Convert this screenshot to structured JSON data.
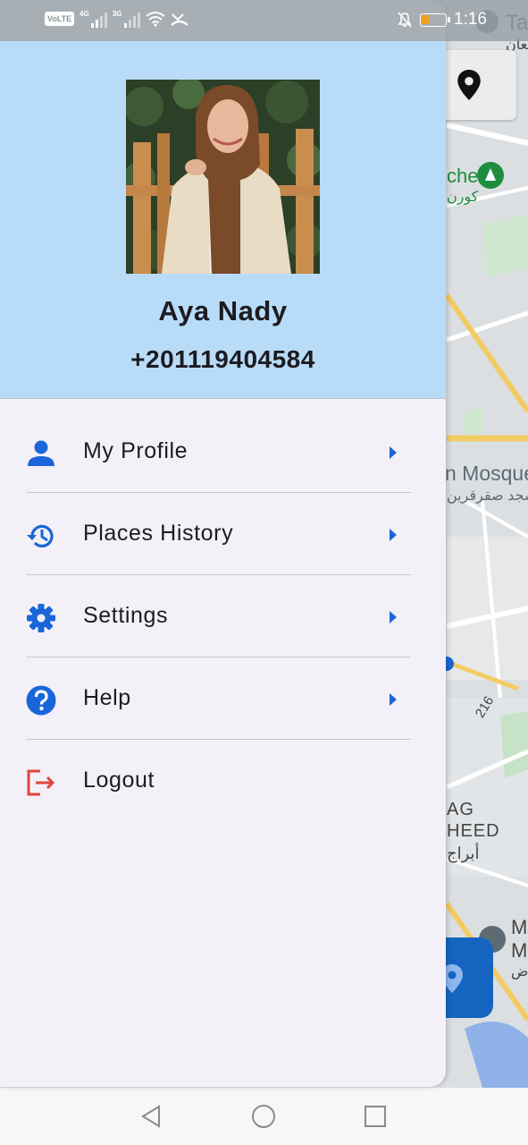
{
  "status_bar": {
    "time": "1:16",
    "network_badge": "VoLTE",
    "network_4g": "4G",
    "network_3g": "3G",
    "icons": [
      "volte-icon",
      "signal-4g-icon",
      "signal-3g-icon",
      "wifi-icon",
      "missed-call-icon",
      "bell-off-icon",
      "battery-icon"
    ]
  },
  "map": {
    "labels": {
      "top_right_a": "Ta",
      "top_right_ar": "بعان",
      "place_a": "che",
      "place_a_ar": "كورن",
      "mosque": "n Mosque",
      "mosque_ar": "سجد صقرقرين",
      "road_number": "216",
      "district_a": "AG",
      "district_b": "HEED",
      "district_ar": "أبراج",
      "bottom_right_a": "M",
      "bottom_right_b": "M",
      "bottom_right_ar": "ض"
    }
  },
  "drawer": {
    "user": {
      "name": "Aya Nady",
      "phone": "+201119404584"
    },
    "menu": [
      {
        "label": "My Profile",
        "icon": "person-icon",
        "has_chevron": true
      },
      {
        "label": "Places History",
        "icon": "history-icon",
        "has_chevron": true
      },
      {
        "label": "Settings",
        "icon": "gear-icon",
        "has_chevron": true
      },
      {
        "label": "Help",
        "icon": "help-icon",
        "has_chevron": true
      },
      {
        "label": "Logout",
        "icon": "logout-icon",
        "has_chevron": false
      }
    ]
  },
  "colors": {
    "header_bg": "#b8dcf8",
    "drawer_bg": "#f4f0f8",
    "accent_blue": "#1a66d9",
    "logout_red": "#e0463c",
    "text": "#1d1b20"
  },
  "nav_bar": {
    "buttons": [
      "back-icon",
      "home-icon",
      "recents-icon"
    ]
  }
}
